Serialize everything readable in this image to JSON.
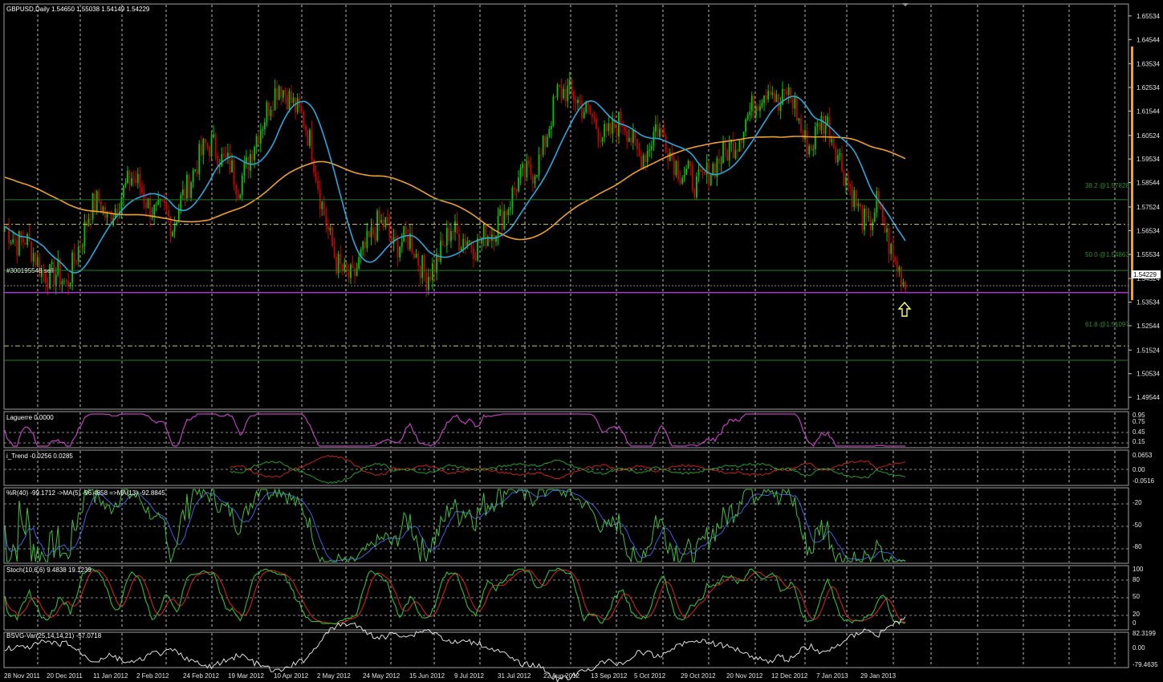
{
  "main": {
    "title": "GBPUSD,Daily  1.54650 1.55038 1.54149 1.54229",
    "price_axis": [
      "1.65534",
      "1.64544",
      "1.63534",
      "1.62534",
      "1.61544",
      "1.60524",
      "1.59534",
      "1.58544",
      "1.57524",
      "1.56534",
      "1.55534",
      "1.54524",
      "1.53534",
      "1.52544",
      "1.51524",
      "1.50534",
      "1.49544"
    ],
    "current_price": "1.54229",
    "order_label": "#300195548 sell",
    "fib_labels": [
      "38.2 @1.57828",
      "50.0 @1.54863",
      "61.8 @1.51097"
    ],
    "colors": {
      "bull": "#00c800",
      "bear": "#c80000",
      "ma_fast": "#29a8e0",
      "ma_slow": "#f0a030",
      "order_line": "#a040d0",
      "fib_line": "#2e7d2e",
      "dash_line": "#c8c864",
      "grid": "#c8c8c8",
      "arrow": "#ffff66"
    }
  },
  "panels": [
    {
      "id": "laguerre",
      "title": "Laguerre 0.0000",
      "axis": [
        "0.95",
        "0.75",
        "0.45",
        "0.15"
      ]
    },
    {
      "id": "itrend",
      "title": "i_Trend -0.0256 0.0285",
      "axis": [
        "0.0653",
        "0.00",
        "-0.0516"
      ]
    },
    {
      "id": "wpr",
      "title": "%R(40) -99.1712  ->MA(5) -96.4858  =>MA(13) -92.8845",
      "axis": [
        "-20",
        "-50",
        "-80"
      ]
    },
    {
      "id": "stoch",
      "title": "Stoch(10,6,6) 9.4838 19.1239",
      "axis": [
        "100",
        "80",
        "50",
        "20",
        "0"
      ]
    },
    {
      "id": "bsvg",
      "title": "BSVG-Var(25,14,14,21) -57.0718",
      "axis": [
        "82.3199",
        "0.00",
        "-79.4635"
      ]
    }
  ],
  "date_axis": [
    "28 Nov 2011",
    "20 Dec 2011",
    "11 Jan 2012",
    "2 Feb 2012",
    "24 Feb 2012",
    "19 Mar 2012",
    "10 Apr 2012",
    "2 May 2012",
    "24 May 2012",
    "15 Jun 2012",
    "9 Jul 2012",
    "31 Jul 2012",
    "22 Aug 2012",
    "13 Sep 2012",
    "5 Oct 2012",
    "29 Oct 2012",
    "20 Nov 2012",
    "12 Dec 2012",
    "7 Jan 2013",
    "29 Jan 2013"
  ],
  "chart_data": {
    "type": "candlestick",
    "symbol": "GBPUSD",
    "timeframe": "Daily",
    "ylim": [
      1.49044,
      1.66034
    ],
    "close_path": [
      [
        0,
        1.567
      ],
      [
        6,
        1.56
      ],
      [
        10,
        1.562
      ],
      [
        14,
        1.556
      ],
      [
        18,
        1.548
      ],
      [
        22,
        1.546
      ],
      [
        26,
        1.548
      ],
      [
        30,
        1.542
      ],
      [
        34,
        1.553
      ],
      [
        38,
        1.563
      ],
      [
        42,
        1.575
      ],
      [
        46,
        1.578
      ],
      [
        50,
        1.57
      ],
      [
        54,
        1.575
      ],
      [
        58,
        1.582
      ],
      [
        62,
        1.588
      ],
      [
        66,
        1.584
      ],
      [
        70,
        1.576
      ],
      [
        74,
        1.572
      ],
      [
        78,
        1.574
      ],
      [
        82,
        1.567
      ],
      [
        86,
        1.578
      ],
      [
        90,
        1.585
      ],
      [
        94,
        1.594
      ],
      [
        98,
        1.601
      ],
      [
        102,
        1.601
      ],
      [
        106,
        1.595
      ],
      [
        110,
        1.593
      ],
      [
        114,
        1.584
      ],
      [
        118,
        1.592
      ],
      [
        122,
        1.603
      ],
      [
        126,
        1.611
      ],
      [
        130,
        1.62
      ],
      [
        134,
        1.627
      ],
      [
        138,
        1.622
      ],
      [
        142,
        1.617
      ],
      [
        146,
        1.612
      ],
      [
        150,
        1.6
      ],
      [
        154,
        1.58
      ],
      [
        158,
        1.565
      ],
      [
        162,
        1.552
      ],
      [
        166,
        1.547
      ],
      [
        170,
        1.545
      ],
      [
        174,
        1.554
      ],
      [
        178,
        1.561
      ],
      [
        182,
        1.568
      ],
      [
        186,
        1.568
      ],
      [
        190,
        1.558
      ],
      [
        194,
        1.561
      ],
      [
        198,
        1.562
      ],
      [
        202,
        1.553
      ],
      [
        206,
        1.546
      ],
      [
        210,
        1.551
      ],
      [
        214,
        1.558
      ],
      [
        218,
        1.567
      ],
      [
        222,
        1.562
      ],
      [
        226,
        1.562
      ],
      [
        230,
        1.558
      ],
      [
        234,
        1.563
      ],
      [
        238,
        1.565
      ],
      [
        242,
        1.57
      ],
      [
        246,
        1.576
      ],
      [
        250,
        1.585
      ],
      [
        254,
        1.589
      ],
      [
        258,
        1.59
      ],
      [
        262,
        1.596
      ],
      [
        266,
        1.61
      ],
      [
        270,
        1.623
      ],
      [
        274,
        1.624
      ],
      [
        278,
        1.622
      ],
      [
        282,
        1.617
      ],
      [
        286,
        1.614
      ],
      [
        290,
        1.608
      ],
      [
        294,
        1.604
      ],
      [
        298,
        1.609
      ],
      [
        302,
        1.612
      ],
      [
        306,
        1.604
      ],
      [
        310,
        1.596
      ],
      [
        314,
        1.599
      ],
      [
        318,
        1.609
      ],
      [
        322,
        1.605
      ],
      [
        326,
        1.596
      ],
      [
        330,
        1.59
      ],
      [
        334,
        1.589
      ],
      [
        338,
        1.584
      ],
      [
        342,
        1.588
      ],
      [
        346,
        1.592
      ],
      [
        350,
        1.596
      ],
      [
        354,
        1.6
      ],
      [
        358,
        1.603
      ],
      [
        362,
        1.612
      ],
      [
        366,
        1.618
      ],
      [
        370,
        1.623
      ],
      [
        374,
        1.627
      ],
      [
        378,
        1.616
      ],
      [
        382,
        1.624
      ],
      [
        386,
        1.618
      ],
      [
        390,
        1.604
      ],
      [
        394,
        1.6
      ],
      [
        398,
        1.611
      ],
      [
        402,
        1.61
      ],
      [
        406,
        1.6
      ],
      [
        410,
        1.59
      ],
      [
        414,
        1.581
      ],
      [
        418,
        1.572
      ],
      [
        422,
        1.566
      ],
      [
        426,
        1.577
      ],
      [
        430,
        1.566
      ],
      [
        434,
        1.553
      ],
      [
        438,
        1.547
      ],
      [
        440,
        1.542
      ]
    ]
  }
}
